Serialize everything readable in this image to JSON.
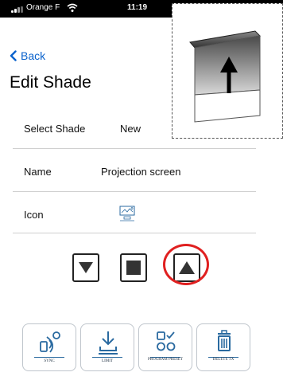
{
  "status_bar": {
    "carrier": "Orange F",
    "time": "11:19"
  },
  "nav": {
    "back_label": "Back",
    "title": "Edit Shade"
  },
  "rows": {
    "select_shade": {
      "label": "Select Shade",
      "value": "New"
    },
    "name": {
      "label": "Name",
      "value": "Projection screen"
    },
    "icon": {
      "label": "Icon",
      "icon": "projector-shade-icon"
    }
  },
  "controls": [
    "down-triangle-icon",
    "stop-square-icon",
    "up-triangle-icon"
  ],
  "tiles": [
    {
      "label": "SYNC",
      "icon": "sync-signal-icon"
    },
    {
      "label": "LIMIT",
      "icon": "limit-download-icon"
    },
    {
      "label": "PROGRAM PRESET",
      "icon": "program-preset-icon"
    },
    {
      "label": "DELETE TX",
      "icon": "trash-icon"
    }
  ],
  "colors": {
    "accent": "#0a62cc",
    "highlight_ring": "#e02020",
    "tile_icon": "#2a6aa0"
  }
}
